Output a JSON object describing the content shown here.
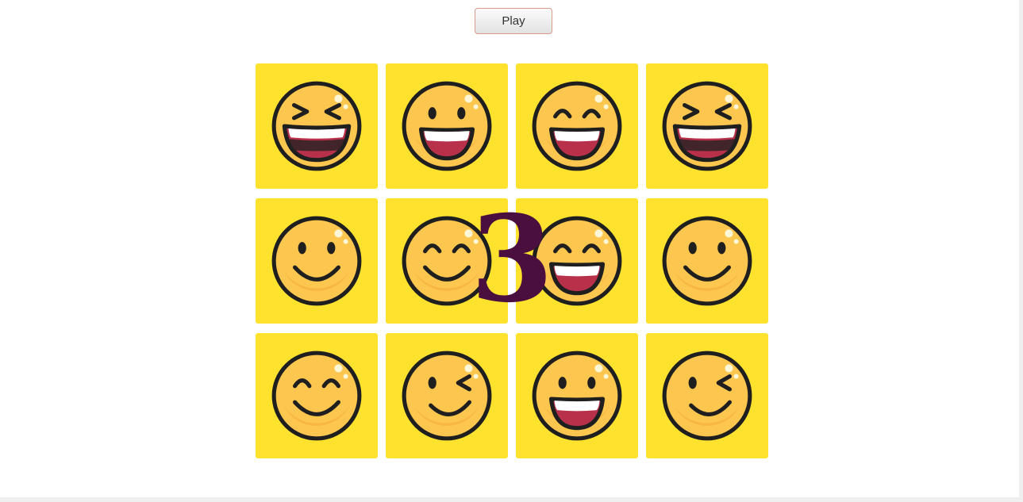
{
  "controls": {
    "play_label": "Play"
  },
  "countdown": {
    "value": "3"
  },
  "colors": {
    "card": "#ffe22e",
    "face": "#fdc64e",
    "outline": "#1f1f1f",
    "mouth": "#b8304a",
    "countdown": "#4a0f3f"
  },
  "cards": [
    {
      "face": "laughing-squint"
    },
    {
      "face": "grinning"
    },
    {
      "face": "smiling-open"
    },
    {
      "face": "laughing-squint"
    },
    {
      "face": "smiling"
    },
    {
      "face": "happy-closed-eyes"
    },
    {
      "face": "smiling-open"
    },
    {
      "face": "smiling"
    },
    {
      "face": "happy-closed-eyes"
    },
    {
      "face": "winking"
    },
    {
      "face": "grinning"
    },
    {
      "face": "winking"
    }
  ]
}
